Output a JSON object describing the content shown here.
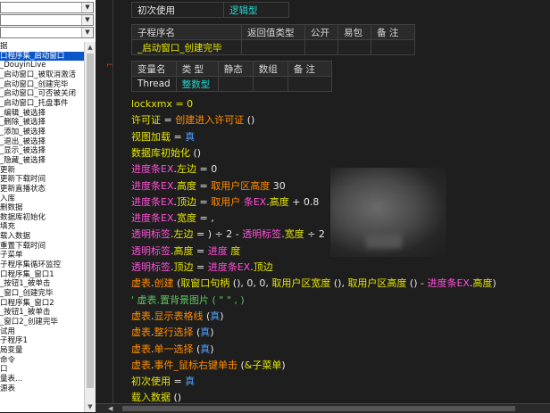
{
  "tree_items": [
    "据",
    "口程序集_启动窗口",
    "_DouyinLive",
    "_启动窗口_被取消激活",
    "_启动窗口_创建完毕",
    "_启动窗口_可否被关闭",
    "_启动窗口_托盘事件",
    "_编辑_被选择",
    "_删除_被选择",
    "_添加_被选择",
    "_退出_被选择",
    "_显示_被选择",
    "_隐藏_被选择",
    "更新",
    "更新下载时间",
    "更新直播状态",
    "入库",
    "删数据",
    "数据库初始化",
    "填充",
    "载入数据",
    "重置下载时间",
    "子菜单",
    "子程序集循环监控",
    "口程序集_窗口1",
    "_按钮1_被单击",
    "_窗口_创建完毕",
    "口程序集_窗口2",
    "_按钮1_被单击",
    "_窗口2_创建完毕",
    "试用",
    "子程序1",
    "局变量",
    "命令",
    "口",
    "量表...",
    "源表"
  ],
  "selected_index": 1,
  "top_row": {
    "label": "初次使用",
    "value": "逻辑型"
  },
  "sub_header": [
    "子程序名",
    "返回值类型",
    "公开",
    "易包",
    "备 注"
  ],
  "sub_row": [
    "_启动窗口_创建完毕",
    "",
    "",
    "",
    ""
  ],
  "var_header": [
    "变量名",
    "类 型",
    "静态",
    "数组",
    "备 注"
  ],
  "var_row": [
    "Thread",
    "整数型",
    "",
    "",
    ""
  ],
  "code_lines": [
    [
      {
        "t": "lockxmx",
        "c": "yel"
      },
      {
        "t": " = 0",
        "c": "yel"
      }
    ],
    [
      {
        "t": "许可证",
        "c": "yel"
      },
      {
        "t": " = ",
        "c": "wht"
      },
      {
        "t": "创建进入许可证",
        "c": "org"
      },
      {
        "t": " ()",
        "c": "wht"
      }
    ],
    [
      {
        "t": "视图加载",
        "c": "yel"
      },
      {
        "t": " = ",
        "c": "wht"
      },
      {
        "t": "真",
        "c": "bl"
      }
    ],
    [
      {
        "t": "数据库初始化",
        "c": "yel"
      },
      {
        "t": " ()",
        "c": "wht"
      }
    ],
    [
      {
        "t": "进度条EX",
        "c": "mag"
      },
      {
        "t": ".",
        "c": "wht"
      },
      {
        "t": "左边",
        "c": "yel"
      },
      {
        "t": " = 0",
        "c": "wht"
      }
    ],
    [
      {
        "t": "进度条EX",
        "c": "mag"
      },
      {
        "t": ".",
        "c": "wht"
      },
      {
        "t": "高度",
        "c": "yel"
      },
      {
        "t": " = ",
        "c": "wht"
      },
      {
        "t": "取用户区高度",
        "c": "org"
      },
      {
        "t": "    30",
        "c": "wht"
      }
    ],
    [
      {
        "t": "进度条EX",
        "c": "mag"
      },
      {
        "t": ".",
        "c": "wht"
      },
      {
        "t": "顶边",
        "c": "yel"
      },
      {
        "t": " = ",
        "c": "wht"
      },
      {
        "t": "取用户",
        "c": "org"
      },
      {
        "t": "         ",
        "c": "wht"
      },
      {
        "t": "条EX",
        "c": "mag"
      },
      {
        "t": ".",
        "c": "wht"
      },
      {
        "t": "高度",
        "c": "yel"
      },
      {
        "t": " + 0.8",
        "c": "wht"
      }
    ],
    [
      {
        "t": "进度条EX",
        "c": "mag"
      },
      {
        "t": ".",
        "c": "wht"
      },
      {
        "t": "宽度",
        "c": "yel"
      },
      {
        "t": " = ",
        "c": "wht"
      },
      {
        "t": "           ,",
        "c": "wht"
      }
    ],
    [
      {
        "t": "透明标签",
        "c": "mag"
      },
      {
        "t": ".",
        "c": "wht"
      },
      {
        "t": "左边",
        "c": "yel"
      },
      {
        "t": " = ",
        "c": "wht"
      },
      {
        "t": "           ) ÷ 2 - ",
        "c": "wht"
      },
      {
        "t": "透明标签",
        "c": "mag"
      },
      {
        "t": ".",
        "c": "wht"
      },
      {
        "t": "宽度",
        "c": "yel"
      },
      {
        "t": " ÷ 2",
        "c": "wht"
      }
    ],
    [
      {
        "t": "透明标签",
        "c": "mag"
      },
      {
        "t": ".",
        "c": "wht"
      },
      {
        "t": "高度",
        "c": "yel"
      },
      {
        "t": " = ",
        "c": "wht"
      },
      {
        "t": "进度",
        "c": "mag"
      },
      {
        "t": "     ",
        "c": "wht"
      },
      {
        "t": "度",
        "c": "yel"
      }
    ],
    [
      {
        "t": "透明标签",
        "c": "mag"
      },
      {
        "t": ".",
        "c": "wht"
      },
      {
        "t": "顶边",
        "c": "yel"
      },
      {
        "t": " = ",
        "c": "wht"
      },
      {
        "t": "进度条EX",
        "c": "mag"
      },
      {
        "t": ".",
        "c": "wht"
      },
      {
        "t": "顶边",
        "c": "yel"
      }
    ],
    [
      {
        "t": "虚表",
        "c": "org"
      },
      {
        "t": ".",
        "c": "wht"
      },
      {
        "t": "创建",
        "c": "org"
      },
      {
        "t": " (",
        "c": "wht"
      },
      {
        "t": "取窗口句柄",
        "c": "yel"
      },
      {
        "t": " (), 0, 0, ",
        "c": "wht"
      },
      {
        "t": "取用户区宽度",
        "c": "yel"
      },
      {
        "t": " (), ",
        "c": "wht"
      },
      {
        "t": "取用户区高度",
        "c": "yel"
      },
      {
        "t": " () - ",
        "c": "wht"
      },
      {
        "t": "进度条EX",
        "c": "mag"
      },
      {
        "t": ".",
        "c": "wht"
      },
      {
        "t": "高度",
        "c": "yel"
      },
      {
        "t": ")",
        "c": "wht"
      }
    ],
    [
      {
        "t": "' 虚表.置背景图片 ( \" \" , )",
        "c": "grn"
      }
    ],
    [
      {
        "t": "虚表",
        "c": "org"
      },
      {
        "t": ".",
        "c": "wht"
      },
      {
        "t": "显示表格线",
        "c": "org"
      },
      {
        "t": " (",
        "c": "wht"
      },
      {
        "t": "真",
        "c": "bl"
      },
      {
        "t": ")",
        "c": "wht"
      }
    ],
    [
      {
        "t": "虚表",
        "c": "org"
      },
      {
        "t": ".",
        "c": "wht"
      },
      {
        "t": "整行选择",
        "c": "org"
      },
      {
        "t": " (",
        "c": "wht"
      },
      {
        "t": "真",
        "c": "bl"
      },
      {
        "t": ")",
        "c": "wht"
      }
    ],
    [
      {
        "t": "虚表",
        "c": "org"
      },
      {
        "t": ".",
        "c": "wht"
      },
      {
        "t": "单一选择",
        "c": "org"
      },
      {
        "t": " (",
        "c": "wht"
      },
      {
        "t": "真",
        "c": "bl"
      },
      {
        "t": ")",
        "c": "wht"
      }
    ],
    [
      {
        "t": "虚表",
        "c": "org"
      },
      {
        "t": ".",
        "c": "wht"
      },
      {
        "t": "事件_鼠标右键单击",
        "c": "org"
      },
      {
        "t": " (",
        "c": "wht"
      },
      {
        "t": "&子菜单",
        "c": "yel"
      },
      {
        "t": ")",
        "c": "wht"
      }
    ],
    [
      {
        "t": "初次使用",
        "c": "yel"
      },
      {
        "t": " = ",
        "c": "wht"
      },
      {
        "t": "真",
        "c": "bl"
      }
    ],
    [
      {
        "t": "载入数据",
        "c": "yel"
      },
      {
        "t": " ()",
        "c": "wht"
      }
    ],
    [
      {
        "t": "初次使用",
        "c": "yel"
      },
      {
        "t": " = ",
        "c": "wht"
      },
      {
        "t": "假",
        "c": "bl"
      }
    ]
  ]
}
